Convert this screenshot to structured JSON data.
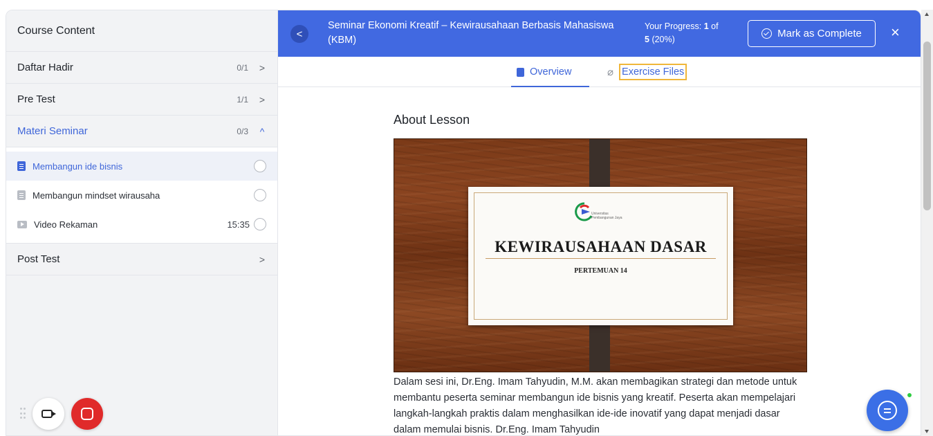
{
  "sidebar": {
    "header": "Course Content",
    "topics": [
      {
        "title": "Daftar Hadir",
        "count": "0/1",
        "chevron": ">"
      },
      {
        "title": "Pre Test",
        "count": "1/1",
        "chevron": ">"
      },
      {
        "title": "Materi Seminar",
        "count": "0/3",
        "chevron": "^"
      }
    ],
    "lessons": [
      {
        "title": "Membangun ide bisnis",
        "icon": "document-icon",
        "duration": ""
      },
      {
        "title": "Membangun mindset wirausaha",
        "icon": "document-icon",
        "duration": ""
      },
      {
        "title": "Video Rekaman",
        "icon": "video-icon",
        "duration": "15:35"
      }
    ],
    "post_test": {
      "title": "Post Test",
      "chevron": ">"
    }
  },
  "topbar": {
    "back_icon": "<",
    "course_title": "Seminar Ekonomi Kreatif – Kewirausahaan Berbasis Mahasiswa (KBM)",
    "progress_label": "Your Progress:",
    "progress_value": "1",
    "progress_of": "of",
    "progress_total": "5",
    "progress_percent": "(20%)",
    "mark_complete": "Mark as Complete",
    "close_icon": "×"
  },
  "tabs": {
    "overview": "Overview",
    "exercise_files": "Exercise Files"
  },
  "content": {
    "heading": "About Lesson",
    "slide_title": "KEWIRAUSAHAAN DASAR",
    "slide_subtitle": "PERTEMUAN 14",
    "slide_logo_text_1": "Universitas",
    "slide_logo_text_2": "Pembangunan Jaya",
    "description": "Dalam sesi ini, Dr.Eng. Imam Tahyudin, M.M. akan membagikan strategi dan metode untuk membantu peserta seminar membangun ide bisnis yang kreatif. Peserta akan mempelajari langkah-langkah praktis dalam menghasilkan ide-ide inovatif yang dapat menjadi dasar dalam memulai bisnis. Dr.Eng. Imam Tahyudin"
  },
  "colors": {
    "brand_blue": "#4169e1",
    "active_text": "#3f66d9",
    "highlight_border": "#f0b63a",
    "record_red": "#e02a2a",
    "online_green": "#2ecc40"
  }
}
